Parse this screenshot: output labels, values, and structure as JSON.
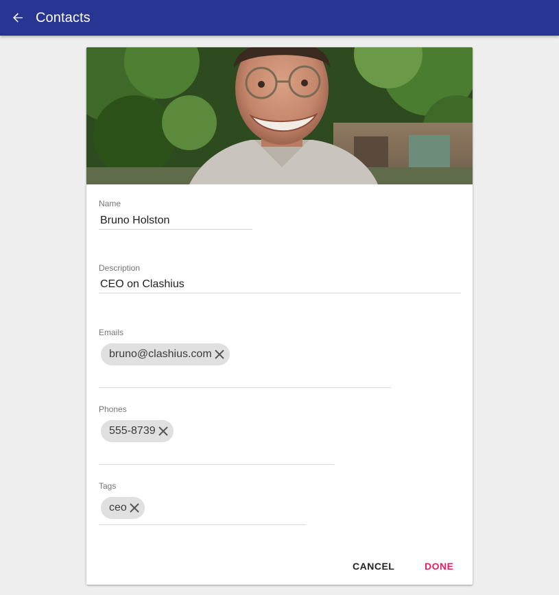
{
  "appbar": {
    "title": "Contacts",
    "color": "#283593"
  },
  "contact": {
    "name_label": "Name",
    "name_value": "Bruno Holston",
    "description_label": "Description",
    "description_value": "CEO on Clashius",
    "emails_label": "Emails",
    "emails": [
      "bruno@clashius.com"
    ],
    "phones_label": "Phones",
    "phones": [
      "555-8739"
    ],
    "tags_label": "Tags",
    "tags": [
      "ceo"
    ]
  },
  "actions": {
    "cancel_label": "CANCEL",
    "done_label": "DONE",
    "accent_color": "#e91e63"
  },
  "icons": {
    "back": "arrow-left-icon",
    "chip_remove": "close-icon"
  }
}
